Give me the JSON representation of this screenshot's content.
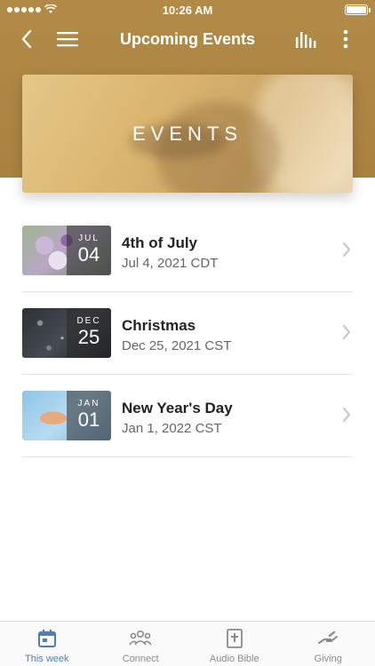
{
  "status_bar": {
    "time": "10:26 AM"
  },
  "nav": {
    "title": "Upcoming Events"
  },
  "hero": {
    "title": "EVENTS"
  },
  "events": [
    {
      "month": "JUL",
      "day": "04",
      "title": "4th of July",
      "date": "Jul 4, 2021 CDT"
    },
    {
      "month": "DEC",
      "day": "25",
      "title": "Christmas",
      "date": "Dec 25, 2021 CST"
    },
    {
      "month": "JAN",
      "day": "01",
      "title": "New Year's Day",
      "date": "Jan 1, 2022 CST"
    }
  ],
  "tabs": [
    {
      "label": "This week",
      "icon": "calendar-icon",
      "active": true
    },
    {
      "label": "Connect",
      "icon": "people-icon",
      "active": false
    },
    {
      "label": "Audio Bible",
      "icon": "bible-icon",
      "active": false
    },
    {
      "label": "Giving",
      "icon": "giving-hand-icon",
      "active": false
    }
  ],
  "colors": {
    "header": "#b18a47",
    "accent": "#4a7fb8"
  }
}
